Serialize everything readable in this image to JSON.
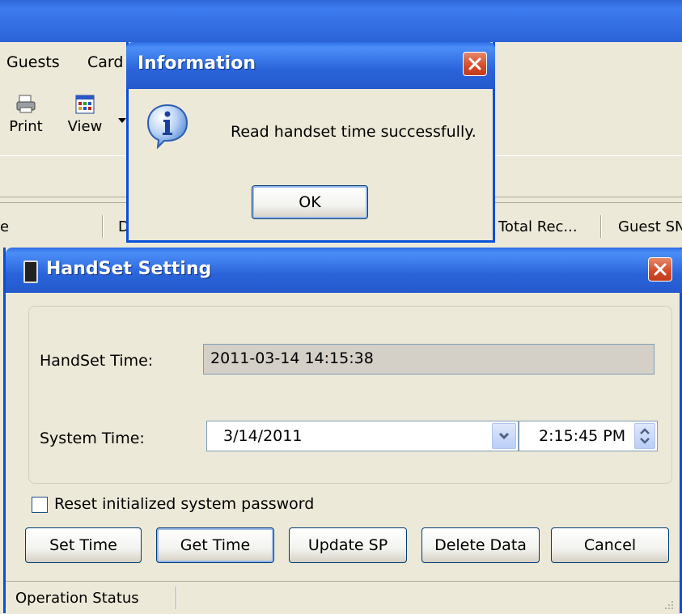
{
  "main_window": {
    "menu": {
      "guests_label": "Guests",
      "card_label": "Card"
    },
    "toolbar": {
      "print_label": "Print",
      "view_label": "View"
    },
    "columns": {
      "col_partial_1": "e",
      "col_partial_2": "D",
      "total_records": "Total Rec...",
      "guest_sn": "Guest SN"
    }
  },
  "info_dialog": {
    "title": "Information",
    "message": "Read handset time successfully.",
    "ok_label": "OK",
    "icon": "information-icon"
  },
  "handset_dialog": {
    "title": "HandSet Setting",
    "handset_time_label": "HandSet Time:",
    "handset_time_value": "2011-03-14 14:15:38",
    "system_time_label": "System Time:",
    "system_date_value": "3/14/2011",
    "system_time_value": "2:15:45 PM",
    "reset_password_label": "Reset initialized system password",
    "reset_password_checked": false,
    "buttons": {
      "set_time": "Set Time",
      "get_time": "Get Time",
      "update_sp": "Update SP",
      "delete_data": "Delete Data",
      "cancel": "Cancel"
    },
    "status_label": "Operation Status"
  },
  "colors": {
    "titlebar_blue": "#2459cc",
    "close_red": "#d24b2a",
    "dialog_bg": "#ece9d8"
  }
}
